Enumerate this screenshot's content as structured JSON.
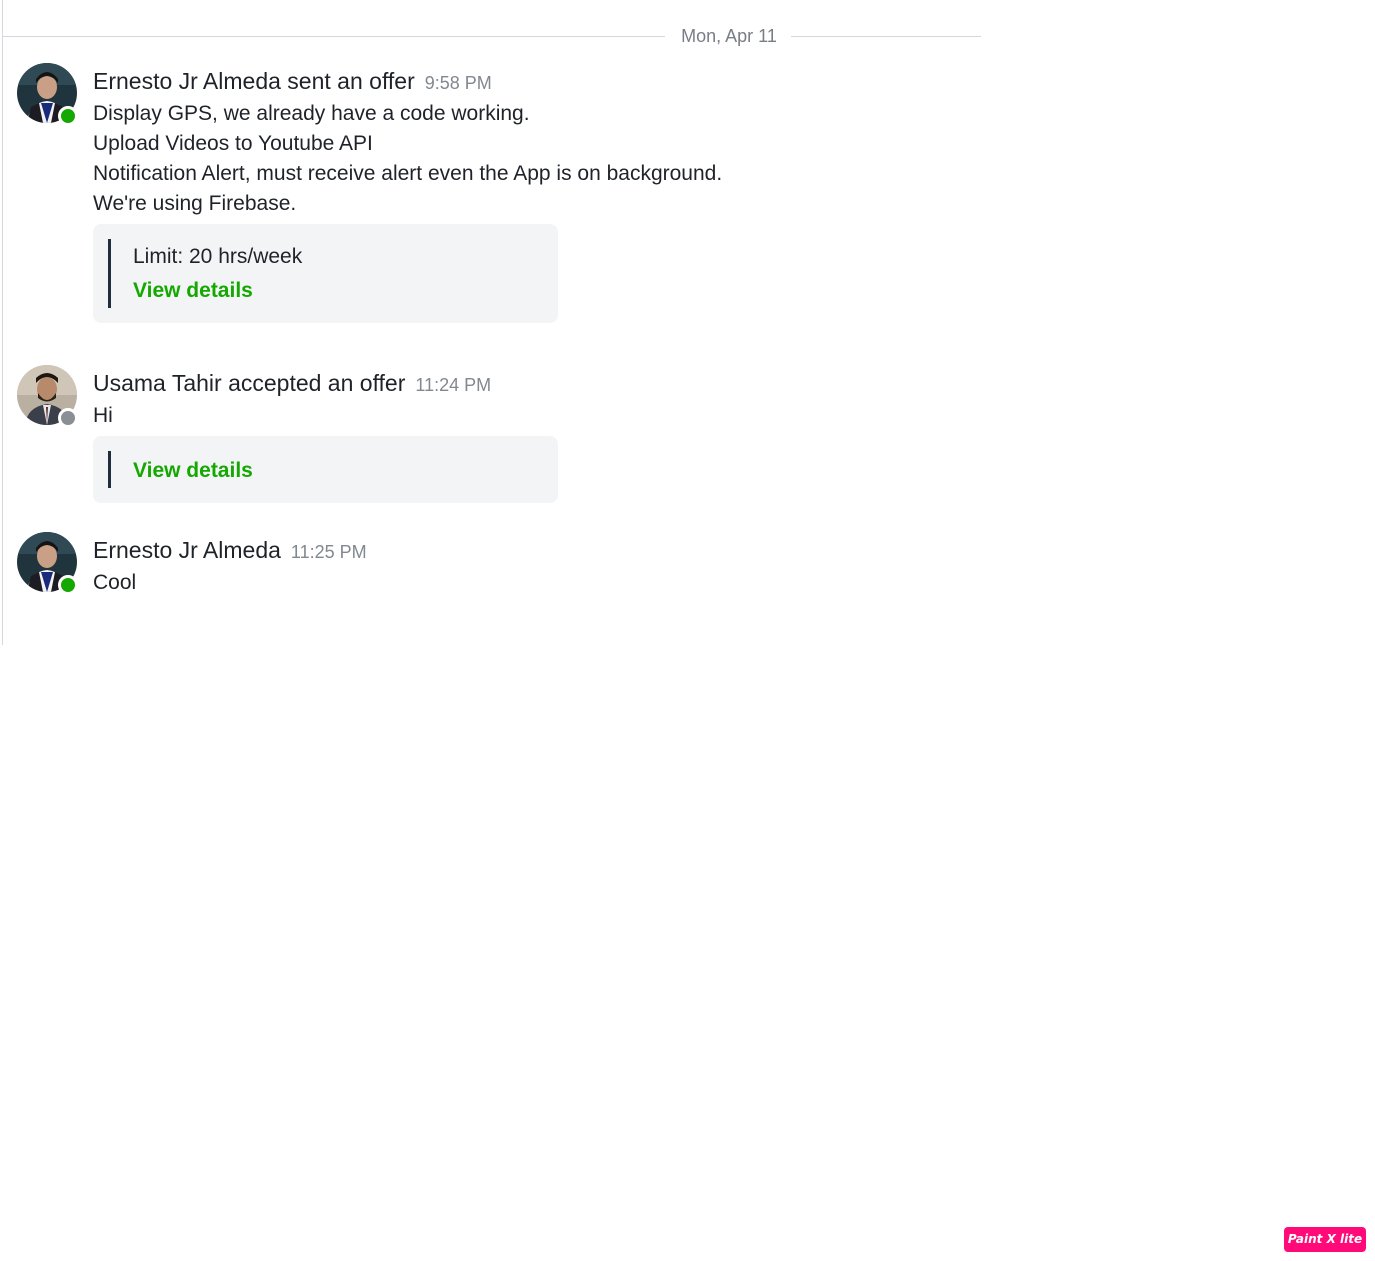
{
  "conversation": {
    "date_divider": "Mon, Apr 11",
    "messages": [
      {
        "sender": "Ernesto Jr Almeda sent an offer",
        "time": "9:58 PM",
        "presence": "online",
        "lines": [
          "Display GPS, we already have a code working.",
          "Upload Videos to Youtube API",
          "Notification Alert, must receive alert even the App is on background.",
          "We're using Firebase."
        ],
        "offer": {
          "limit": "Limit: 20 hrs/week",
          "link_label": "View details"
        }
      },
      {
        "sender": "Usama Tahir accepted an offer",
        "time": "11:24 PM",
        "presence": "offline",
        "lines": [
          "Hi"
        ],
        "offer": {
          "link_label": "View details"
        }
      },
      {
        "sender": "Ernesto Jr Almeda",
        "time": "11:25 PM",
        "presence": "online",
        "lines": [
          "Cool"
        ]
      }
    ]
  },
  "watermark": {
    "label": "Paint X lite"
  },
  "colors": {
    "accent_green": "#14a800",
    "online": "#14a800",
    "offline": "#8a8f96",
    "card_bg": "#f2f4f6",
    "watermark_bg": "#ff0a78"
  }
}
